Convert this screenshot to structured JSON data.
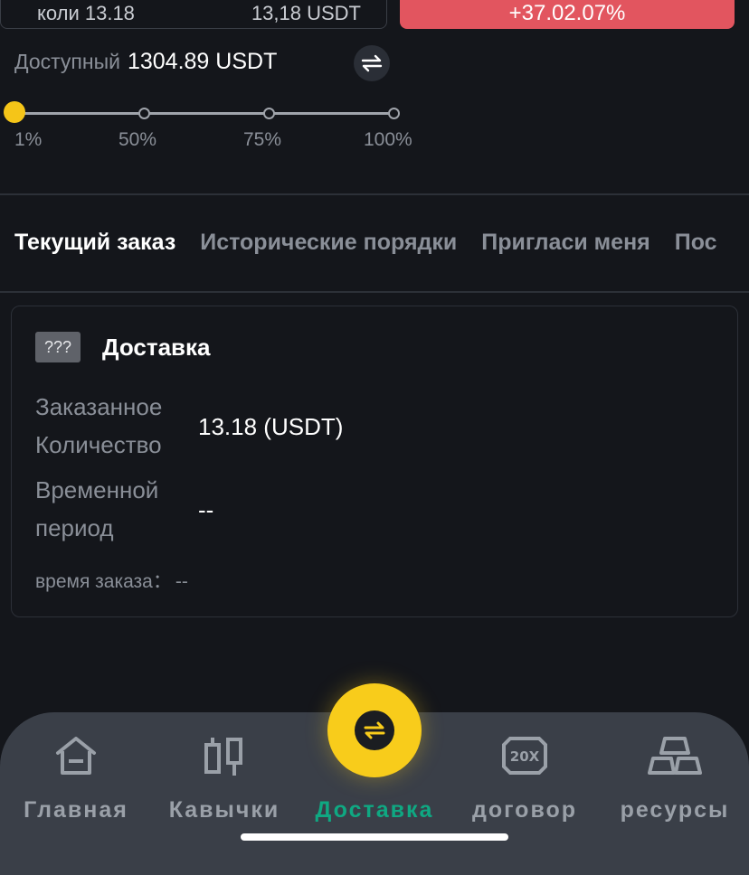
{
  "top": {
    "input_left_text": "коли 13.18",
    "input_right_text": "13,18 USDT",
    "buy_label": "+37.02.07%"
  },
  "balance": {
    "label": "Доступный",
    "value": "1304.89 USDT"
  },
  "slider": {
    "level_percent": 1,
    "stops": [
      "1%",
      "50%",
      "75%",
      "100%"
    ]
  },
  "tabs": [
    {
      "label": "Текущий заказ",
      "active": true
    },
    {
      "label": "Исторические порядки",
      "active": false
    },
    {
      "label": "Пригласи меня",
      "active": false
    },
    {
      "label": "Пос",
      "active": false
    }
  ],
  "order": {
    "badge": "???",
    "title": "Доставка",
    "qty_label_1": "Заказанное",
    "qty_label_2": "Количество",
    "qty_value": "13.18 (USDT)",
    "period_label_1": "Временной",
    "period_label_2": "период",
    "period_value": "--",
    "time_label": "время заказа：",
    "time_value": "--"
  },
  "nav": [
    {
      "label": "Главная",
      "icon": "home-icon",
      "active": false
    },
    {
      "label": "Кавычки",
      "icon": "candlestick-icon",
      "active": false
    },
    {
      "label": "Доставка",
      "icon": "swap-icon",
      "active": true
    },
    {
      "label": "договор",
      "icon": "20x-icon",
      "active": false
    },
    {
      "label": "ресурсы",
      "icon": "gold-bars-icon",
      "active": false
    }
  ],
  "colors": {
    "background": "#14161b",
    "accent_yellow": "#f5c518",
    "active_green": "#0fa882",
    "buy_red": "#e2555f",
    "nav_bg": "#3a3f48"
  }
}
